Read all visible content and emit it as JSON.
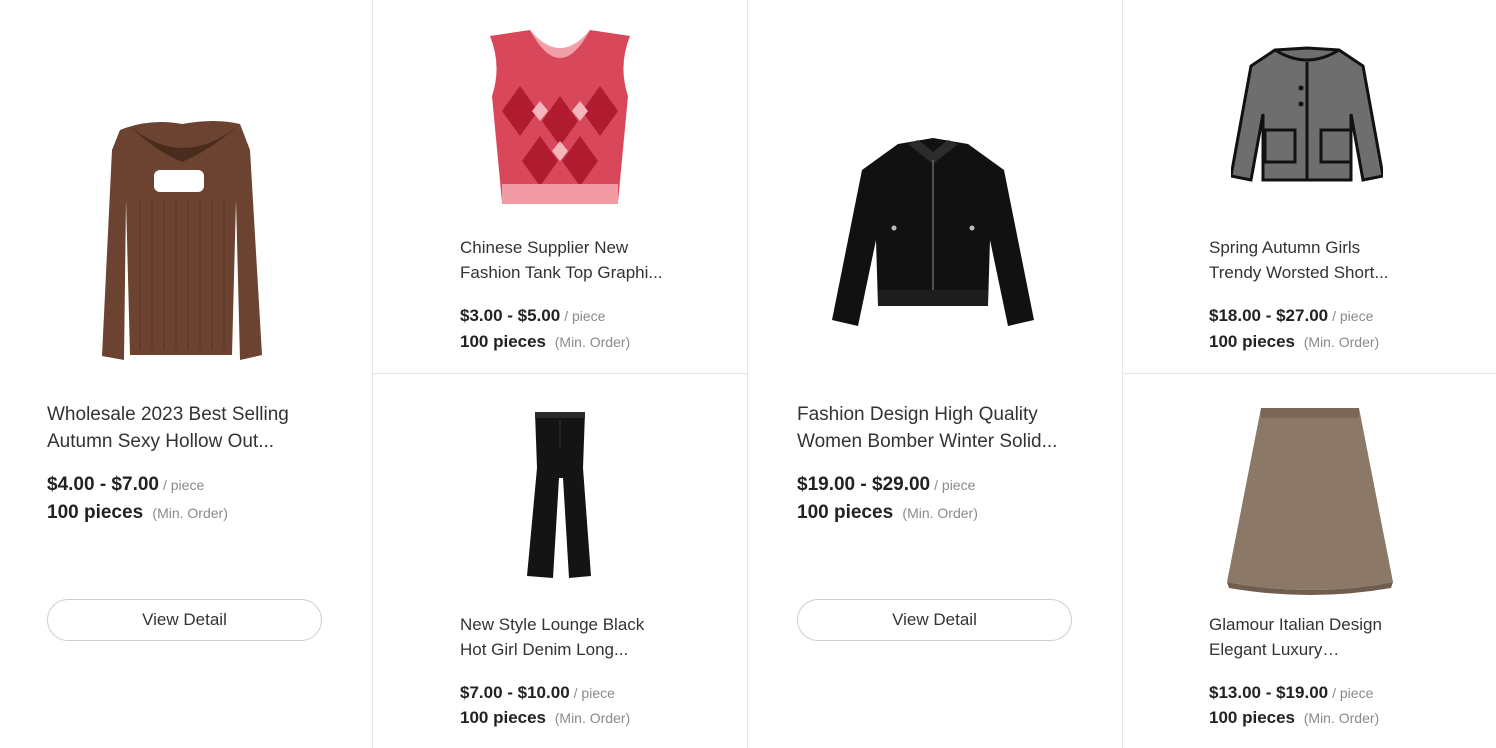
{
  "products": [
    {
      "title": "Wholesale 2023 Best Selling Autumn Sexy Hollow Out...",
      "price": "$4.00 - $7.00",
      "unit": "/ piece",
      "moq": "100 pieces",
      "moq_note": "(Min. Order)",
      "button": "View Detail",
      "image": "brown-sweater"
    },
    {
      "title": "Chinese Supplier New Fashion Tank Top Graphi...",
      "price": "$3.00 - $5.00",
      "unit": "/ piece",
      "moq": "100 pieces",
      "moq_note": "(Min. Order)",
      "image": "red-argyle-vest"
    },
    {
      "title": "New Style Lounge Black Hot Girl Denim Long...",
      "price": "$7.00 - $10.00",
      "unit": "/ piece",
      "moq": "100 pieces",
      "moq_note": "(Min. Order)",
      "image": "black-flare-jeans"
    },
    {
      "title": "Fashion Design High Quality Women Bomber Winter Solid...",
      "price": "$19.00 - $29.00",
      "unit": "/ piece",
      "moq": "100 pieces",
      "moq_note": "(Min. Order)",
      "button": "View Detail",
      "image": "black-bomber-jacket"
    },
    {
      "title": "Spring Autumn Girls Trendy Worsted Short...",
      "price": "$18.00 - $27.00",
      "unit": "/ piece",
      "moq": "100 pieces",
      "moq_note": "(Min. Order)",
      "image": "tweed-jacket"
    },
    {
      "title": "Glamour Italian Design Elegant Luxury European...",
      "price": "$13.00 - $19.00",
      "unit": "/ piece",
      "moq": "100 pieces",
      "moq_note": "(Min. Order)",
      "image": "tan-skirt"
    }
  ]
}
